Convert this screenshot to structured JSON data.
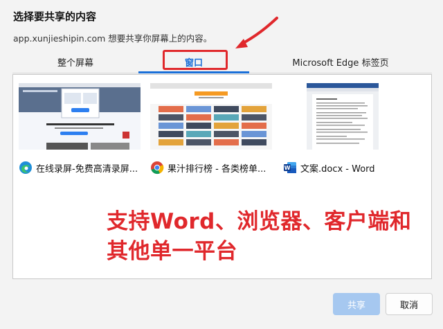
{
  "dialog": {
    "title": "选择要共享的内容",
    "subtitle": "app.xunjieshipin.com 想要共享你屏幕上的内容。"
  },
  "tabs": [
    {
      "label": "整个屏幕",
      "active": false
    },
    {
      "label": "窗口",
      "active": true
    },
    {
      "label": "Microsoft Edge 标签页",
      "active": false
    }
  ],
  "windows": [
    {
      "title": "在线录屏-免费高清录屏...",
      "icon": "edge-icon"
    },
    {
      "title": "果汁排行榜 - 各类榜单...",
      "icon": "chrome-icon"
    },
    {
      "title": "文案.docx - Word",
      "icon": "word-icon"
    }
  ],
  "annotation": {
    "line1": "支持Word、浏览器、客户端和",
    "line2": "其他单一平台"
  },
  "buttons": {
    "share": "共享",
    "cancel": "取消"
  },
  "colors": {
    "accent": "#1a6fd8",
    "annotation_red": "#e0282c",
    "share_disabled": "#a6c8f0"
  }
}
